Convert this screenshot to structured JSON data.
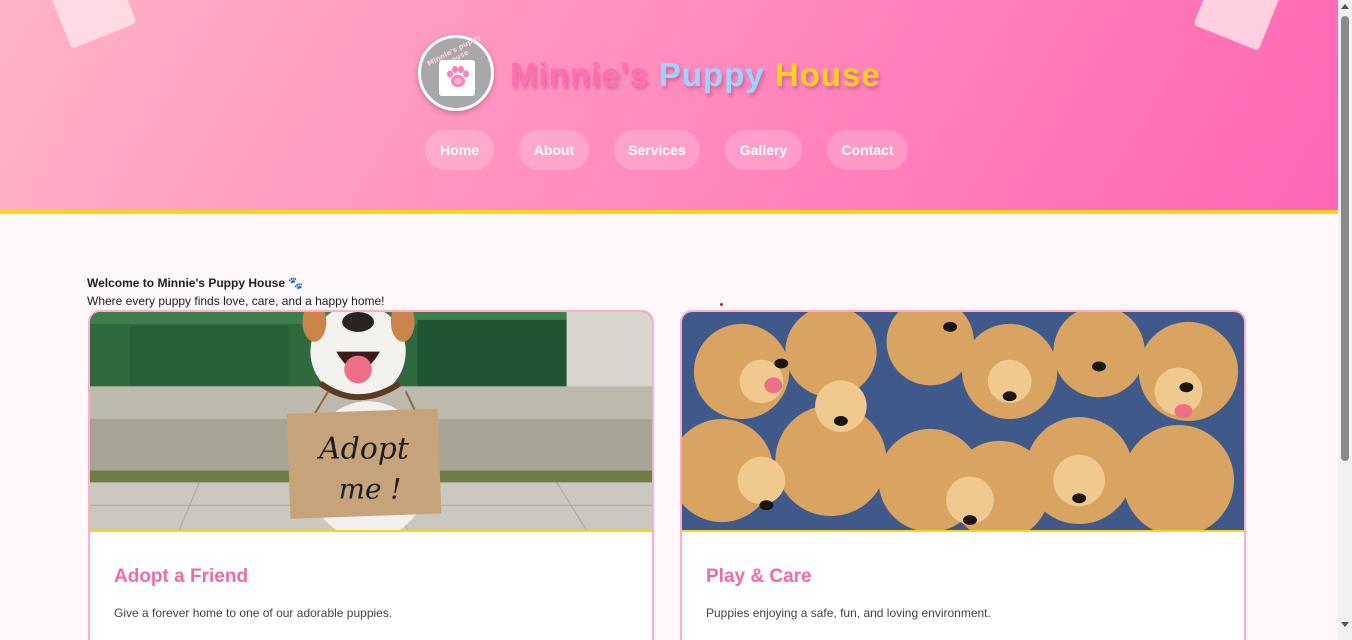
{
  "site": {
    "logo_text": "Minnie's puppy house",
    "title_parts": [
      "Minnie's",
      "Puppy",
      "House"
    ]
  },
  "nav": {
    "items": [
      {
        "label": "Home"
      },
      {
        "label": "About"
      },
      {
        "label": "Services"
      },
      {
        "label": "Gallery"
      },
      {
        "label": "Contact"
      }
    ]
  },
  "welcome": {
    "title": "Welcome to Minnie's Puppy House 🐾",
    "subtitle": "Where every puppy finds love, care, and a happy home!"
  },
  "cards": [
    {
      "sign_line1": "Adopt",
      "sign_line2": "me !",
      "title": "Adopt a Friend",
      "description": "Give a forever home to one of our adorable puppies."
    },
    {
      "title": "Play & Care",
      "description": "Puppies enjoying a safe, fun, and loving environment."
    }
  ],
  "colors": {
    "header_start": "#ffb3c6",
    "header_end": "#ff66b3",
    "accent_yellow": "#ffd21f",
    "title_pink": "#ff6fb0",
    "title_blue": "#9fd3ff",
    "card_title": "#f06aa8"
  },
  "icons": {
    "logo": "paw-icon",
    "welcome": "paw-prints-icon"
  }
}
